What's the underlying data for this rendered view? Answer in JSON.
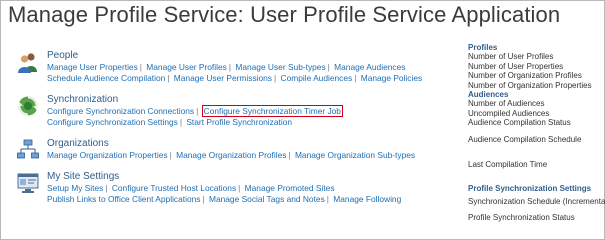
{
  "page_title": "Manage Profile Service: User Profile Service Application",
  "sections": {
    "people": {
      "icon": "people-icon",
      "heading": "People",
      "links": [
        "Manage User Properties",
        "Manage User Profiles",
        "Manage User Sub-types",
        "Manage Audiences",
        "Schedule Audience Compilation",
        "Manage User Permissions",
        "Compile Audiences",
        "Manage Policies"
      ]
    },
    "synchronization": {
      "icon": "sync-globe-icon",
      "heading": "Synchronization",
      "links": [
        "Configure Synchronization Connections",
        "Configure Synchronization Timer Job",
        "Configure Synchronization Settings",
        "Start Profile Synchronization"
      ]
    },
    "organizations": {
      "icon": "org-chart-icon",
      "heading": "Organizations",
      "links": [
        "Manage Organization Properties",
        "Manage Organization Profiles",
        "Manage Organization Sub-types"
      ]
    },
    "mysite": {
      "icon": "my-site-icon",
      "heading": "My Site Settings",
      "links": [
        "Setup My Sites",
        "Configure Trusted Host Locations",
        "Manage Promoted Sites",
        "Publish Links to Office Client Applications",
        "Manage Social Tags and Notes",
        "Manage Following"
      ]
    }
  },
  "sidebar": {
    "profiles_heading": "Profiles",
    "profile_items": [
      "Number of User Profiles",
      "Number of User Properties",
      "Number of Organization Profiles",
      "Number of Organization Properties"
    ],
    "audiences_heading": "Audiences",
    "audience_items": [
      "Number of Audiences",
      "Uncompiled Audiences",
      "Audience Compilation Status"
    ],
    "audience_schedule": "Audience Compilation Schedule",
    "last_compilation": "Last Compilation Time",
    "sync_heading": "Profile Synchronization Settings",
    "sync_schedule": "Synchronization Schedule (Incremental)",
    "sync_status": "Profile Synchronization Status"
  },
  "colors": {
    "link": "#1f6fb5",
    "heading": "#2f5e8c",
    "highlight": "#d0001c"
  }
}
